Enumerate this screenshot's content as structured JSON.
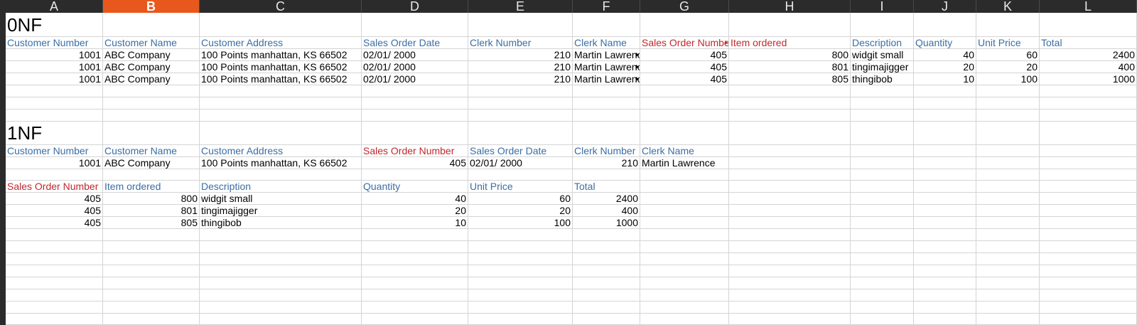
{
  "columns": [
    "A",
    "B",
    "C",
    "D",
    "E",
    "F",
    "G",
    "H",
    "I",
    "J",
    "K",
    "L"
  ],
  "selected_column": "B",
  "nf0": {
    "title": "0NF",
    "headers": [
      "Customer Number",
      "Customer Name",
      "Customer Address",
      "Sales Order Date",
      "Clerk Number",
      "Clerk Name",
      "Sales Order Number",
      "Item ordered",
      "Description",
      "Quantity",
      "Unit Price",
      "Total"
    ],
    "rows": [
      [
        "1001",
        "ABC Company",
        "100 Points manhattan, KS 66502",
        "02/01/ 2000",
        "210",
        "Martin Lawrence",
        "405",
        "800",
        "widgit small",
        "40",
        "60",
        "2400"
      ],
      [
        "1001",
        "ABC Company",
        "100 Points manhattan, KS 66502",
        "02/01/ 2000",
        "210",
        "Martin Lawrence",
        "405",
        "801",
        "tingimajigger",
        "20",
        "20",
        "400"
      ],
      [
        "1001",
        "ABC Company",
        "100 Points manhattan, KS 66502",
        "02/01/ 2000",
        "210",
        "Martin Lawrence",
        "405",
        "805",
        "thingibob",
        "10",
        "100",
        "1000"
      ]
    ]
  },
  "nf1": {
    "title": "1NF",
    "customer_headers": [
      "Customer Number",
      "Customer Name",
      "Customer Address",
      "Sales Order Number",
      "Sales Order Date",
      "Clerk Number",
      "Clerk Name"
    ],
    "customer_row": [
      "1001",
      "ABC Company",
      "100 Points manhattan, KS 66502",
      "405",
      "02/01/ 2000",
      "210",
      "Martin Lawrence"
    ],
    "items_headers": [
      "Sales Order Number",
      "Item ordered",
      "Description",
      "Quantity",
      "Unit Price",
      "Total"
    ],
    "items_rows": [
      [
        "405",
        "800",
        "widgit small",
        "40",
        "60",
        "2400"
      ],
      [
        "405",
        "801",
        "tingimajigger",
        "20",
        "20",
        "400"
      ],
      [
        "405",
        "805",
        "thingibob",
        "10",
        "100",
        "1000"
      ]
    ]
  },
  "colors": {
    "header_blue": "#3a6ea5",
    "header_red": "#c0282d",
    "selected_column_header": "#e8581c",
    "grid": "#d4d4d4",
    "chrome_dark": "#2b2b2b"
  }
}
